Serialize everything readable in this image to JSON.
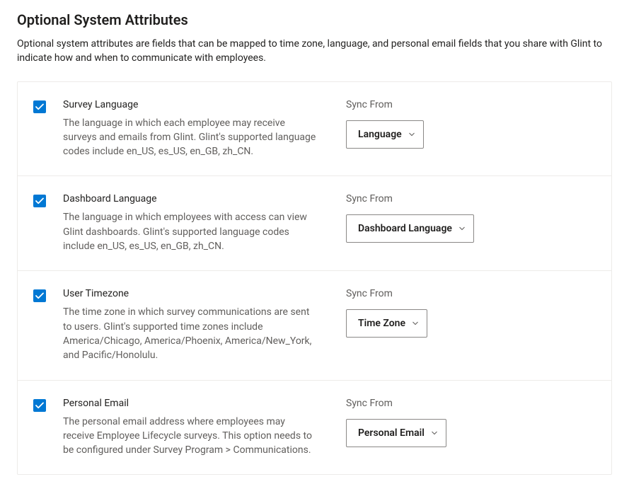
{
  "header": {
    "title": "Optional System Attributes",
    "description": "Optional system attributes are fields that can be mapped to time zone, language, and personal email fields that you share with Glint to indicate how and when to communicate with employees."
  },
  "sync_label": "Sync From",
  "attributes": [
    {
      "checked": true,
      "title": "Survey Language",
      "description": "The language in which each employee may receive surveys and emails from Glint. Glint's supported language codes include en_US, es_US, en_GB, zh_CN.",
      "dropdown": "Language"
    },
    {
      "checked": true,
      "title": "Dashboard Language",
      "description": "The language in which employees with access can view Glint dashboards. Glint's supported language codes include en_US, es_US, en_GB, zh_CN.",
      "dropdown": "Dashboard Language"
    },
    {
      "checked": true,
      "title": "User Timezone",
      "description": "The time zone in which survey communications are sent to users. Glint's supported time zones include America/Chicago, America/Phoenix, America/New_York, and Pacific/Honolulu.",
      "dropdown": "Time Zone"
    },
    {
      "checked": true,
      "title": "Personal Email",
      "description": "The personal email address where employees may receive Employee Lifecycle surveys. This option needs to be configured under Survey Program > Communications.",
      "dropdown": "Personal Email"
    }
  ]
}
